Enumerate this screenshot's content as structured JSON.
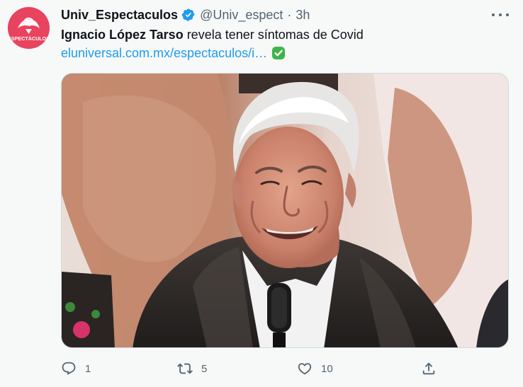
{
  "tweet": {
    "author": {
      "display_name": "Univ_Espectaculos",
      "handle": "@Univ_espect",
      "separator": "·",
      "time": "3h",
      "verified": true,
      "avatar": {
        "text": "ESPECTÁCULOS",
        "color": "#e8435f"
      }
    },
    "text": {
      "bold_part": "Ignacio López Tarso",
      "rest": " revela tener síntomas de Covid"
    },
    "link": "eluniversal.com.mx/espectaculos/i…",
    "link_emoji": "check-mark-button-icon",
    "media": {
      "type": "photo",
      "icon": "photo"
    },
    "actions": {
      "reply": {
        "icon": "reply-icon",
        "count": "1"
      },
      "retweet": {
        "icon": "retweet-icon",
        "count": "5"
      },
      "like": {
        "icon": "heart-icon",
        "count": "10"
      },
      "share": {
        "icon": "share-icon"
      }
    },
    "colors": {
      "link": "#1d9bf0",
      "verified": "#1d9bf0",
      "muted": "#536471",
      "background": "#f7f9f9",
      "emoji_check": "#3bb54a"
    }
  }
}
